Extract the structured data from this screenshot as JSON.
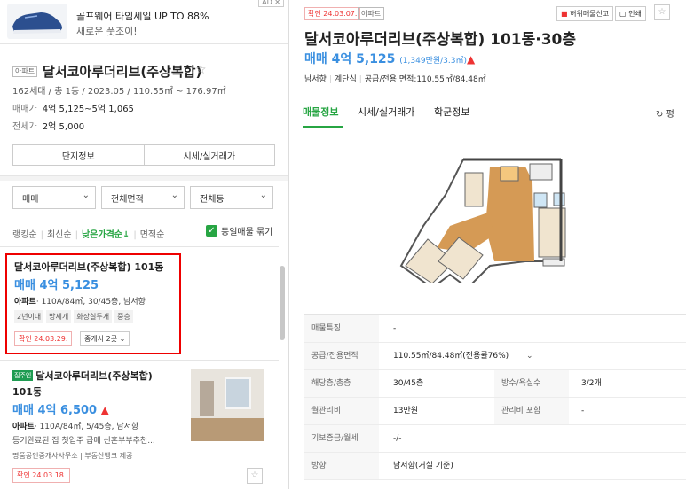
{
  "ad": {
    "badge": "AD ✕",
    "title": "골프웨어 타임세일 UP TO 88%",
    "subtitle": "새로운 풋조이!"
  },
  "complex": {
    "tag": "아파트",
    "title": "달서코아루더리브(주상복합)",
    "meta": "162세대 / 총 1동 / 2023.05 / 110.55㎡ ~ 176.97㎡",
    "sale_label": "매매가",
    "sale_value": "4억 5,125~5억 1,065",
    "lease_label": "전세가",
    "lease_value": "2억 5,000",
    "btn_info": "단지정보",
    "btn_price": "시세/실거래가"
  },
  "filters": {
    "trade": "매매",
    "area": "전체면적",
    "dong": "전체동"
  },
  "sort": {
    "ranking": "랭킹순",
    "latest": "최신순",
    "low_price": "낮은가격순↓",
    "area": "면적순",
    "same_listing": "동일매물 묶기"
  },
  "listings": [
    {
      "title": "달서코아루더리브(주상복합) 101동",
      "price": "매매 4억 5,125",
      "spec_type": "아파트",
      "spec": "· 110A/84㎡, 30/45층, 남서향",
      "tags": [
        "2년이내",
        "방세개",
        "화장실두개",
        "중층"
      ],
      "confirm": "확인 24.03.29.",
      "agents": "중개사 2곳"
    },
    {
      "badge": "집주인",
      "title_line1": "달서코아루더리브(주상복합)",
      "title_line2": "101동",
      "price": "매매 4억 6,500",
      "spec_type": "아파트",
      "spec": "· 110A/84㎡, 5/45층, 남서향",
      "desc": "등기완료된 집  첫입주  급매 신혼부부추천...",
      "agency": "명품공인중개사사무소  |  부동산뱅크 제공",
      "confirm": "확인 24.03.18."
    }
  ],
  "detail": {
    "confirm": "확인 24.03.07.",
    "type": "아파트",
    "report": "허위매물신고",
    "print": "인쇄",
    "title": "달서코아루더리브(주상복합) 101동·30층",
    "price": "매매 4억 5,125",
    "unit_price": "(1,349만원/3.3㎡)",
    "meta_dir": "남서향",
    "meta_stair": "계단식",
    "meta_area": "공급/전용 면적:110.55㎡/84.48㎡",
    "tabs": [
      "매물정보",
      "시세/실거래가",
      "학군정보"
    ],
    "refresh": "평",
    "rows": [
      {
        "k": "매물특징",
        "v": "-"
      },
      {
        "k": "공급/전용면적",
        "v": "110.55㎡/84.48㎡(전용률76%)"
      },
      {
        "k": "해당층/총층",
        "v": "30/45층",
        "k2": "방수/욕실수",
        "v2": "3/2개"
      },
      {
        "k": "월관리비",
        "v": "13만원",
        "k2": "관리비 포함",
        "v2": "-"
      },
      {
        "k": "기보증금/월세",
        "v": "-/-"
      },
      {
        "k": "방향",
        "v": "남서향(거실 기준)"
      }
    ]
  },
  "colors": {
    "accent_green": "#27a543",
    "price_blue": "#3a8fe0",
    "confirm_red": "#e33333",
    "highlight_border": "#e00000"
  }
}
